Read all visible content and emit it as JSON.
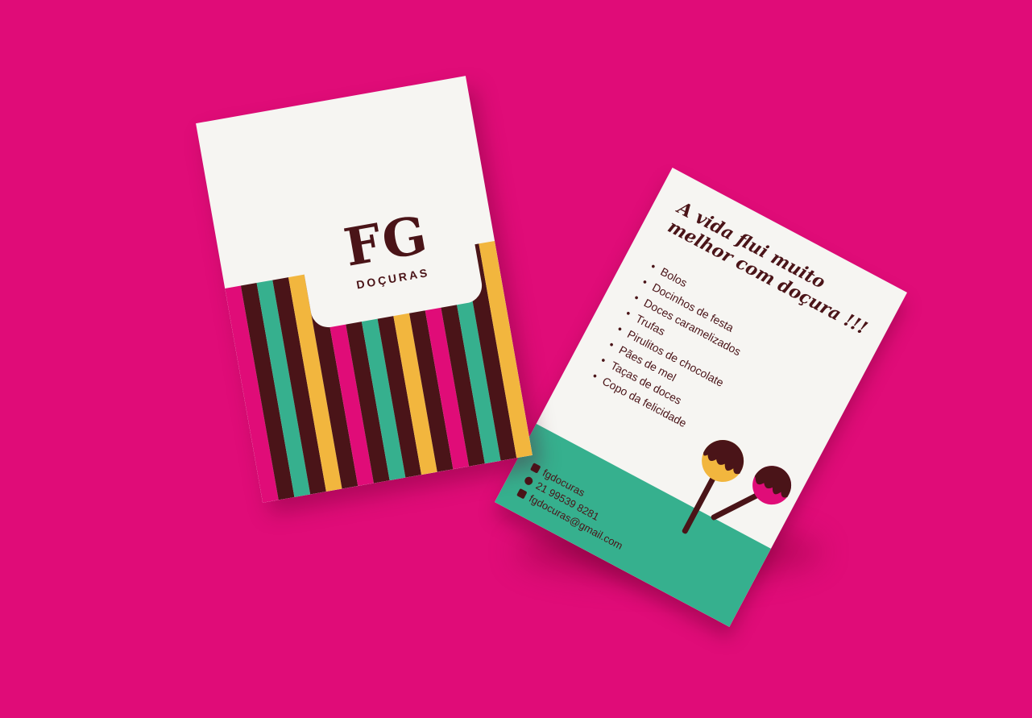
{
  "colors": {
    "background": "#e00c78",
    "card": "#f6f5f2",
    "brown": "#4a1418",
    "green": "#36b08e",
    "yellow": "#f2b63e",
    "magenta": "#e00c78"
  },
  "front_card": {
    "logo_letters": "FG",
    "logo_subtitle": "DOÇURAS",
    "stripe_colors": [
      "#e00c78",
      "#4a1418",
      "#36b08e",
      "#4a1418",
      "#f2b63e",
      "#4a1418",
      "#e00c78",
      "#4a1418",
      "#36b08e",
      "#4a1418",
      "#f2b63e",
      "#4a1418",
      "#e00c78",
      "#4a1418",
      "#36b08e",
      "#4a1418",
      "#f2b63e"
    ]
  },
  "back_card": {
    "headline": "A vida flui muito melhor com doçura !!!",
    "items": [
      "Bolos",
      "Docinhos de festa",
      "Doces caramelizados",
      "Trufas",
      "Pirulitos de chocolate",
      "Pães de mel",
      "Taças de doces",
      "Copo da felicidade"
    ],
    "contacts": {
      "instagram_icon": "instagram-icon",
      "instagram": "fgdocuras",
      "phone_icon": "whatsapp-icon",
      "phone": "21 99539 8281",
      "email_icon": "mail-icon",
      "email": "fgdocuras@gmail.com"
    }
  }
}
